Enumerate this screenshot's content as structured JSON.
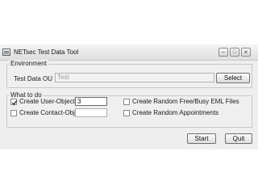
{
  "window": {
    "title": "NETsec Test Data Tool"
  },
  "environment": {
    "group_label": "Environment",
    "test_data_ou_label": "Test Data OU",
    "test_data_ou_value": "Test",
    "select_label": "Select"
  },
  "todo": {
    "group_label": "What to do",
    "create_users_label": "Create User-Objects",
    "create_users_checked": true,
    "create_users_count": "3",
    "create_contacts_label": "Create Contact-Objects",
    "create_contacts_checked": false,
    "create_contacts_count": "",
    "freebusy_label": "Create Random Free/Busy EML Files",
    "freebusy_checked": false,
    "appointments_label": "Create Random Appointments",
    "appointments_checked": false
  },
  "footer": {
    "start_label": "Start",
    "quit_label": "Quit"
  },
  "colors": {
    "window_bg": "#eeeeee",
    "border": "#c8c8c8"
  }
}
